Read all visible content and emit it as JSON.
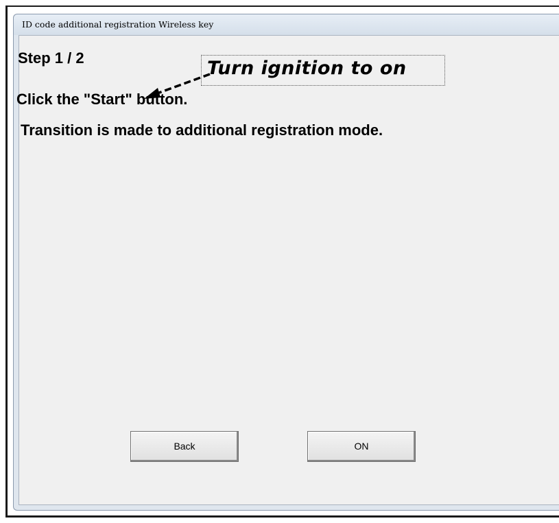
{
  "window": {
    "title": "ID code additional registration  Wireless key"
  },
  "content": {
    "step": "Step 1 / 2",
    "instruction": "Click the \"Start\" button.",
    "transition_note": "Transition is made to additional registration mode."
  },
  "annotation": {
    "text": "Turn ignition to on"
  },
  "buttons": {
    "back_label": "Back",
    "on_label": "ON"
  }
}
